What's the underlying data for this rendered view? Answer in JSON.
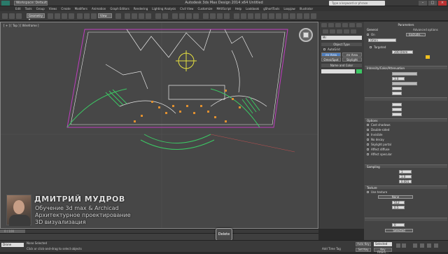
{
  "titlebar": {
    "workspace": "Workspace: Default",
    "title": "Autodesk 3ds Max Design 2014 x64     Untitled",
    "search_placeholder": "Type a keyword or phrase"
  },
  "menubar": [
    "Edit",
    "Tools",
    "Group",
    "Views",
    "Create",
    "Modifiers",
    "Animation",
    "Graph Editors",
    "Rendering",
    "Lighting Analysis",
    "Civil View",
    "Customize",
    "MAXScript",
    "Help",
    "Lookbook",
    "Help",
    "gShortTools",
    "Help",
    "Loopjaw",
    "Illustrator"
  ],
  "toolbar": {
    "selection_set": "Geometry ▾",
    "view_dropdown": "View"
  },
  "viewport": {
    "label": "[ + ] [ Top ] [ Wireframe ]"
  },
  "overlay": {
    "name": "ДМИТРИЙ МУДРОВ",
    "line1": "Обучение 3d max & Archicad",
    "line2": "Архитектурное проектирование",
    "line3": "3D визуализация"
  },
  "delete_button": "Delete",
  "timebar": {
    "frame": "0 / 100"
  },
  "statusbar": {
    "maxscript": "Drone",
    "selected": "None Selected",
    "prompt": "Click or click-and-drag to select objects",
    "autokey": "Auto Key",
    "selected_dropdown": "Selected",
    "set_key": "Set Key",
    "key_filters": "Key Filters...",
    "add_time_tag": "Add Time Tag"
  },
  "command_panel": {
    "object_name": "Mr",
    "object_type_header": "Object Type",
    "autogrid": "AutoGrid",
    "buttons": [
      "mr Area Omni",
      "mr Area Spot",
      "Omni/Spot",
      "Skylight"
    ],
    "name_color_header": "Name and Color"
  },
  "rollout": {
    "parameters": "Parameters",
    "general": "General",
    "on": "On",
    "exclude": "Exclude...",
    "type": "Omni",
    "targeted": "Targeted",
    "targ_dist": "200.0mm",
    "intensity_header": "Intensity/Color/Attenuation",
    "multiplier": "1.0",
    "options": "Options",
    "cast_shadows": "Cast shadows",
    "double_sided": "Double-sided",
    "invisible": "Invisible",
    "no_decay": "No decay",
    "skylight_portal": "Skylight portal",
    "affect_diffuse": "Affect diffuse",
    "affect_specular": "Affect specular",
    "advanced_options": "Advanced options",
    "sampling": "Sampling",
    "texture": "Texture",
    "use_texture": "Use texture",
    "none": "None",
    "resolution": "512",
    "adaptiveness": "0.5",
    "samples": "1",
    "shadow_bias": "1.0",
    "cutoff": "0.001",
    "spread": "0",
    "selected_label": "Selected",
    "exposure_label": "mr Photographic Exposure"
  },
  "colors": {
    "viewport_bg": "#474747",
    "accent_blue": "#4f7fbf",
    "wire_magenta": "#c03cc0",
    "wire_white": "#e8e8e8",
    "wire_green": "#3cc864",
    "wire_yellow": "#e6e040"
  }
}
